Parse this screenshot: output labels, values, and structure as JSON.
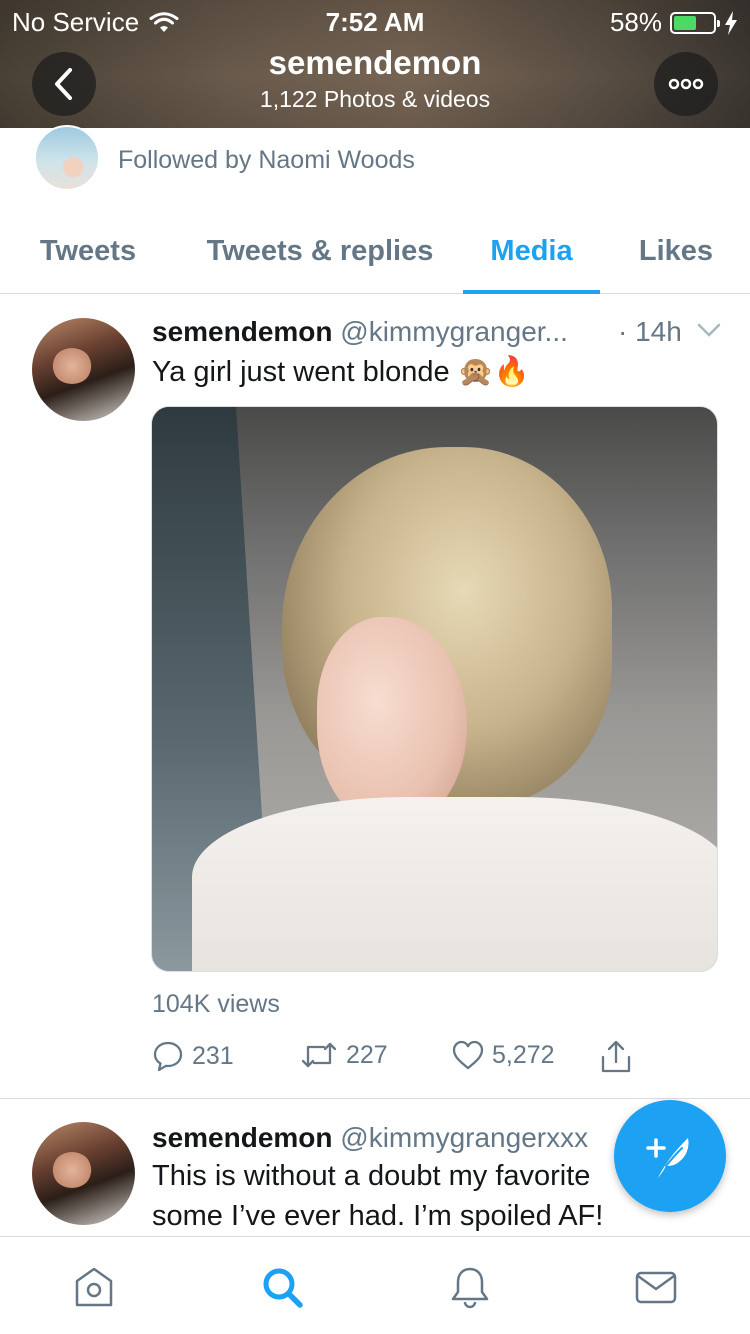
{
  "status_bar": {
    "carrier": "No Service",
    "time": "7:52 AM",
    "battery_percent": "58%",
    "battery_level": 0.58
  },
  "header": {
    "title": "semendemon",
    "subtitle": "1,122 Photos & videos",
    "back_icon": "chevron-left-icon",
    "more_icon": "more-icon"
  },
  "followed_by": {
    "text": "Followed by Naomi Woods"
  },
  "tabs": [
    {
      "label": "Tweets",
      "active": false
    },
    {
      "label": "Tweets & replies",
      "active": false
    },
    {
      "label": "Media",
      "active": true
    },
    {
      "label": "Likes",
      "active": false
    }
  ],
  "tweets": [
    {
      "name": "semendemon",
      "handle": "@kimmygranger...",
      "time": "· 14h",
      "text": "Ya girl just went blonde 🙊🔥",
      "views": "104K views",
      "replies": "231",
      "retweets": "227",
      "likes": "5,272"
    },
    {
      "name": "semendemon",
      "handle": "@kimmygrangerxxx",
      "text_line1": "This is without a doubt my favorite",
      "text_line2": "some I’ve ever had. I’m spoiled AF!"
    }
  ],
  "colors": {
    "accent": "#1da1f2",
    "secondary_text": "#657786",
    "primary_text": "#14171a",
    "border": "#d8dee3"
  },
  "bottom_nav": [
    "home-icon",
    "search-icon",
    "notifications-icon",
    "messages-icon"
  ],
  "fab_icon": "compose-tweet-icon"
}
